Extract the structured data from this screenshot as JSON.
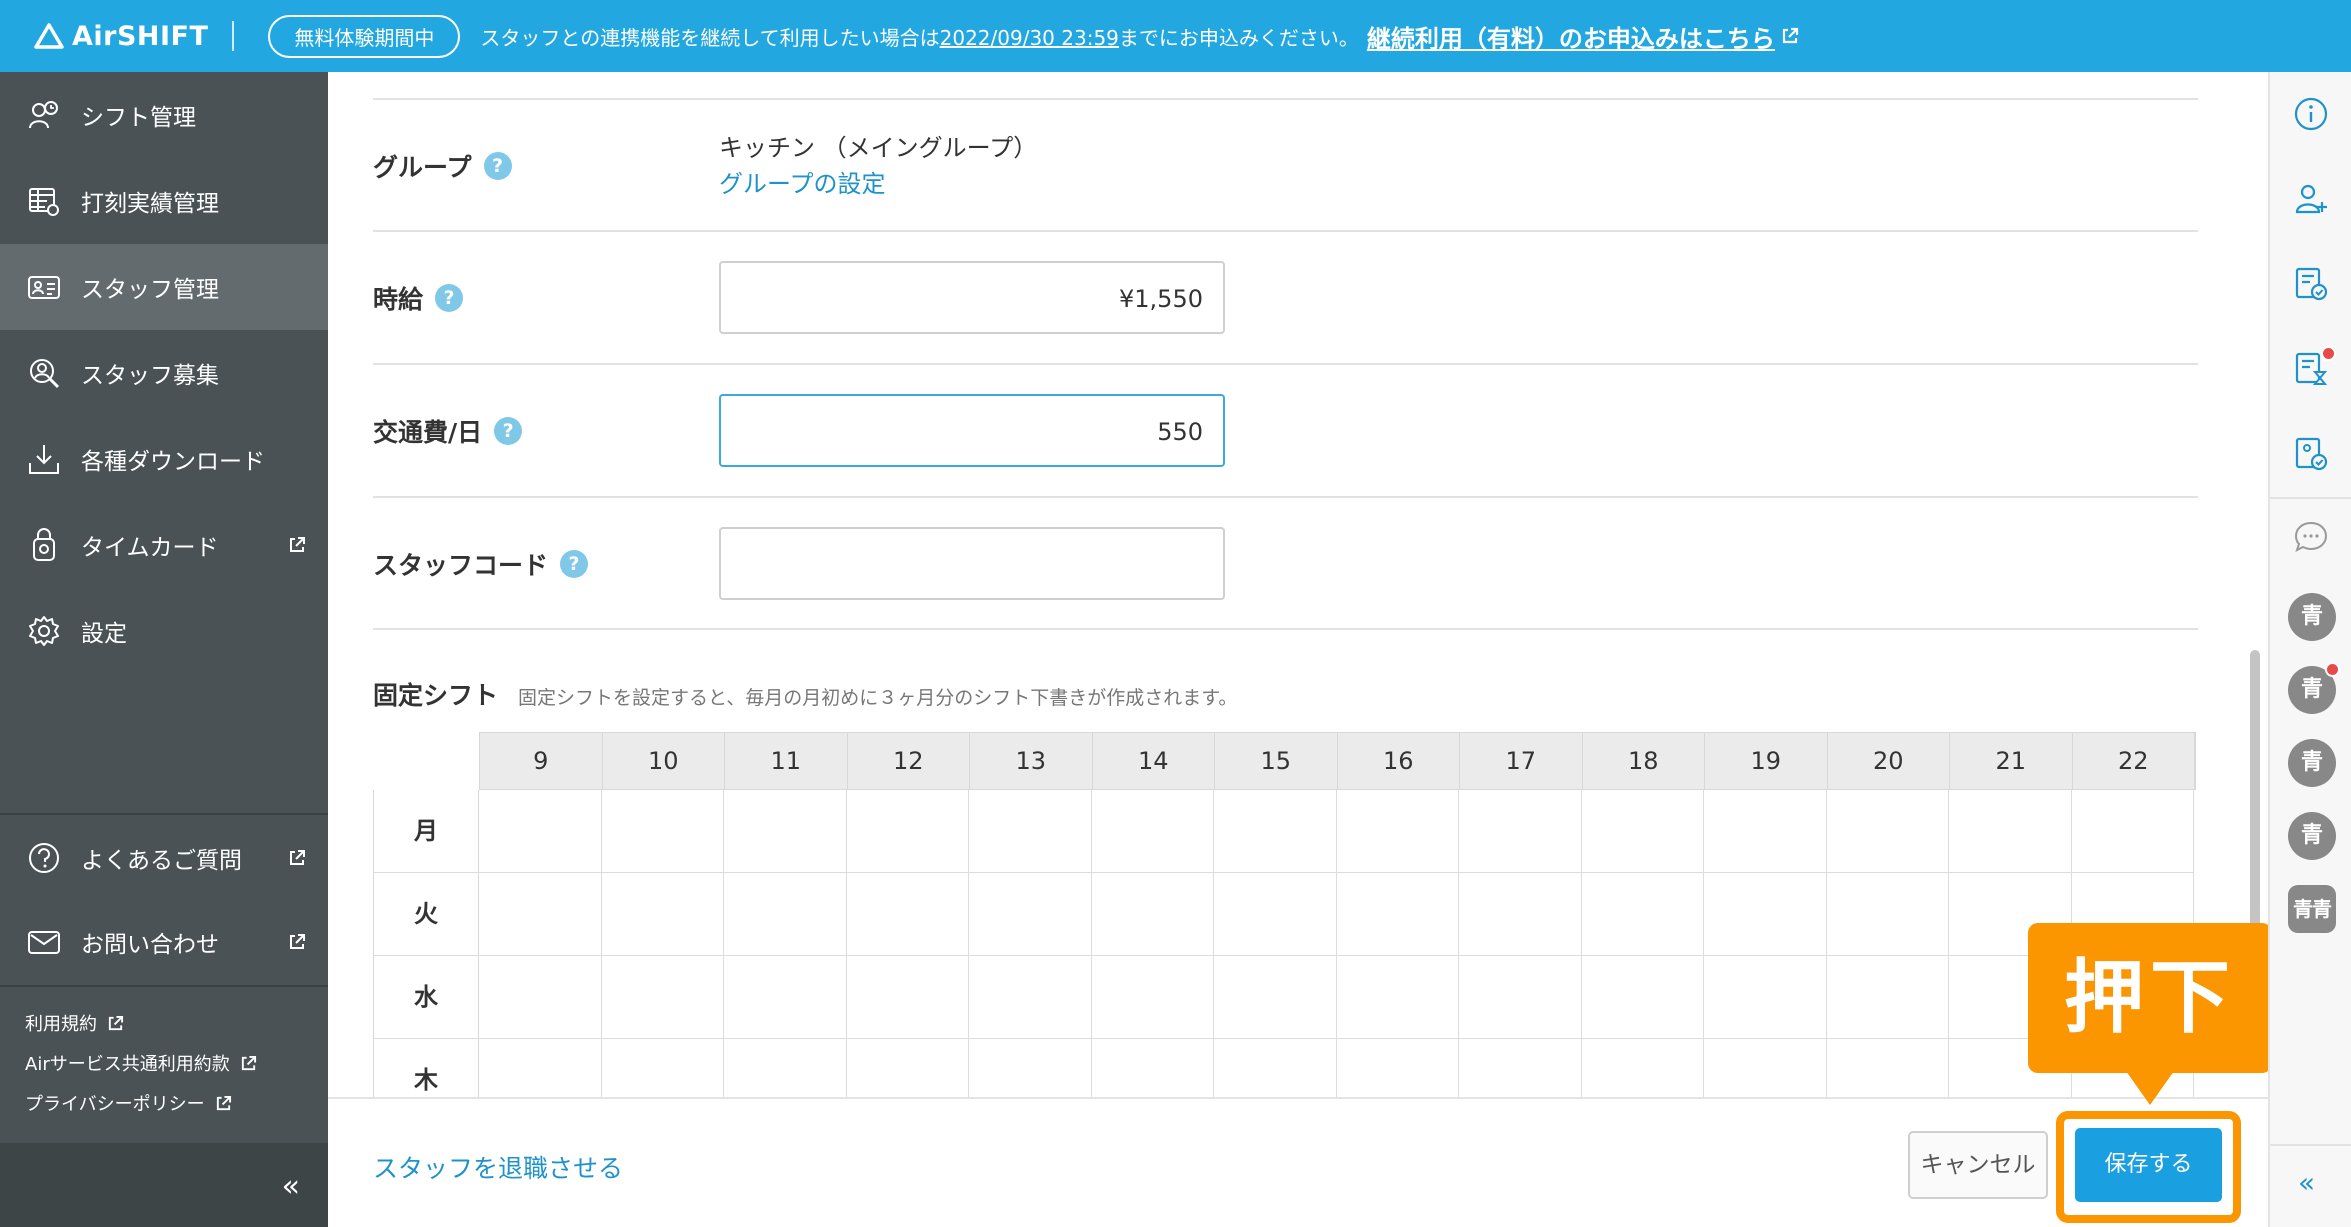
{
  "banner": {
    "logo": "AirSHIFT",
    "trial_badge": "無料体験期間中",
    "message_pre": "スタッフとの連携機能を継続して利用したい場合は",
    "message_date": "2022/09/30 23:59",
    "message_post": "までにお申込みください。",
    "link": "継続利用（有料）のお申込みはこちら"
  },
  "sidebar": {
    "items": [
      {
        "label": "シフト管理",
        "icon": "shift-icon"
      },
      {
        "label": "打刻実績管理",
        "icon": "timesheet-icon"
      },
      {
        "label": "スタッフ管理",
        "icon": "staff-card-icon",
        "active": true
      },
      {
        "label": "スタッフ募集",
        "icon": "recruit-icon"
      },
      {
        "label": "各種ダウンロード",
        "icon": "download-icon"
      },
      {
        "label": "タイムカード",
        "icon": "timecard-icon",
        "external": true
      },
      {
        "label": "設定",
        "icon": "gear-icon"
      }
    ],
    "support": [
      {
        "label": "よくあるご質問",
        "icon": "question-icon",
        "external": true
      },
      {
        "label": "お問い合わせ",
        "icon": "mail-icon",
        "external": true
      }
    ],
    "legal": [
      "利用規約",
      "Airサービス共通利用約款",
      "プライバシーポリシー"
    ],
    "collapse": "«"
  },
  "form": {
    "group_label": "グループ",
    "group_value": "キッチン （メイングループ）",
    "group_link": "グループの設定",
    "wage_label": "時給",
    "wage_value": "¥1,550",
    "transport_label": "交通費/日",
    "transport_value": "550",
    "staff_code_label": "スタッフコード",
    "staff_code_value": ""
  },
  "fixed_shift": {
    "title": "固定シフト",
    "description": "固定シフトを設定すると、毎月の月初めに３ヶ月分のシフト下書きが作成されます。",
    "hours": [
      "9",
      "10",
      "11",
      "12",
      "13",
      "14",
      "15",
      "16",
      "17",
      "18",
      "19",
      "20",
      "21",
      "22"
    ],
    "days": [
      "月",
      "火",
      "水",
      "木"
    ]
  },
  "footer": {
    "retire_link": "スタッフを退職させる",
    "cancel": "キャンセル",
    "save": "保存する"
  },
  "callout": "押下",
  "right_panel": {
    "icons": [
      "info-icon",
      "add-user-icon",
      "document-check-icon",
      "document-timer-icon",
      "document-approval-icon",
      "chat-icon"
    ],
    "avatars": [
      "青",
      "青",
      "青",
      "青",
      "青青"
    ],
    "collapse": "«"
  },
  "colors": {
    "brand": "#22a7e0",
    "sidebar": "#4a5255",
    "accent_orange": "#fb9500",
    "link": "#1f93c9",
    "notification": "#e84a4a"
  }
}
